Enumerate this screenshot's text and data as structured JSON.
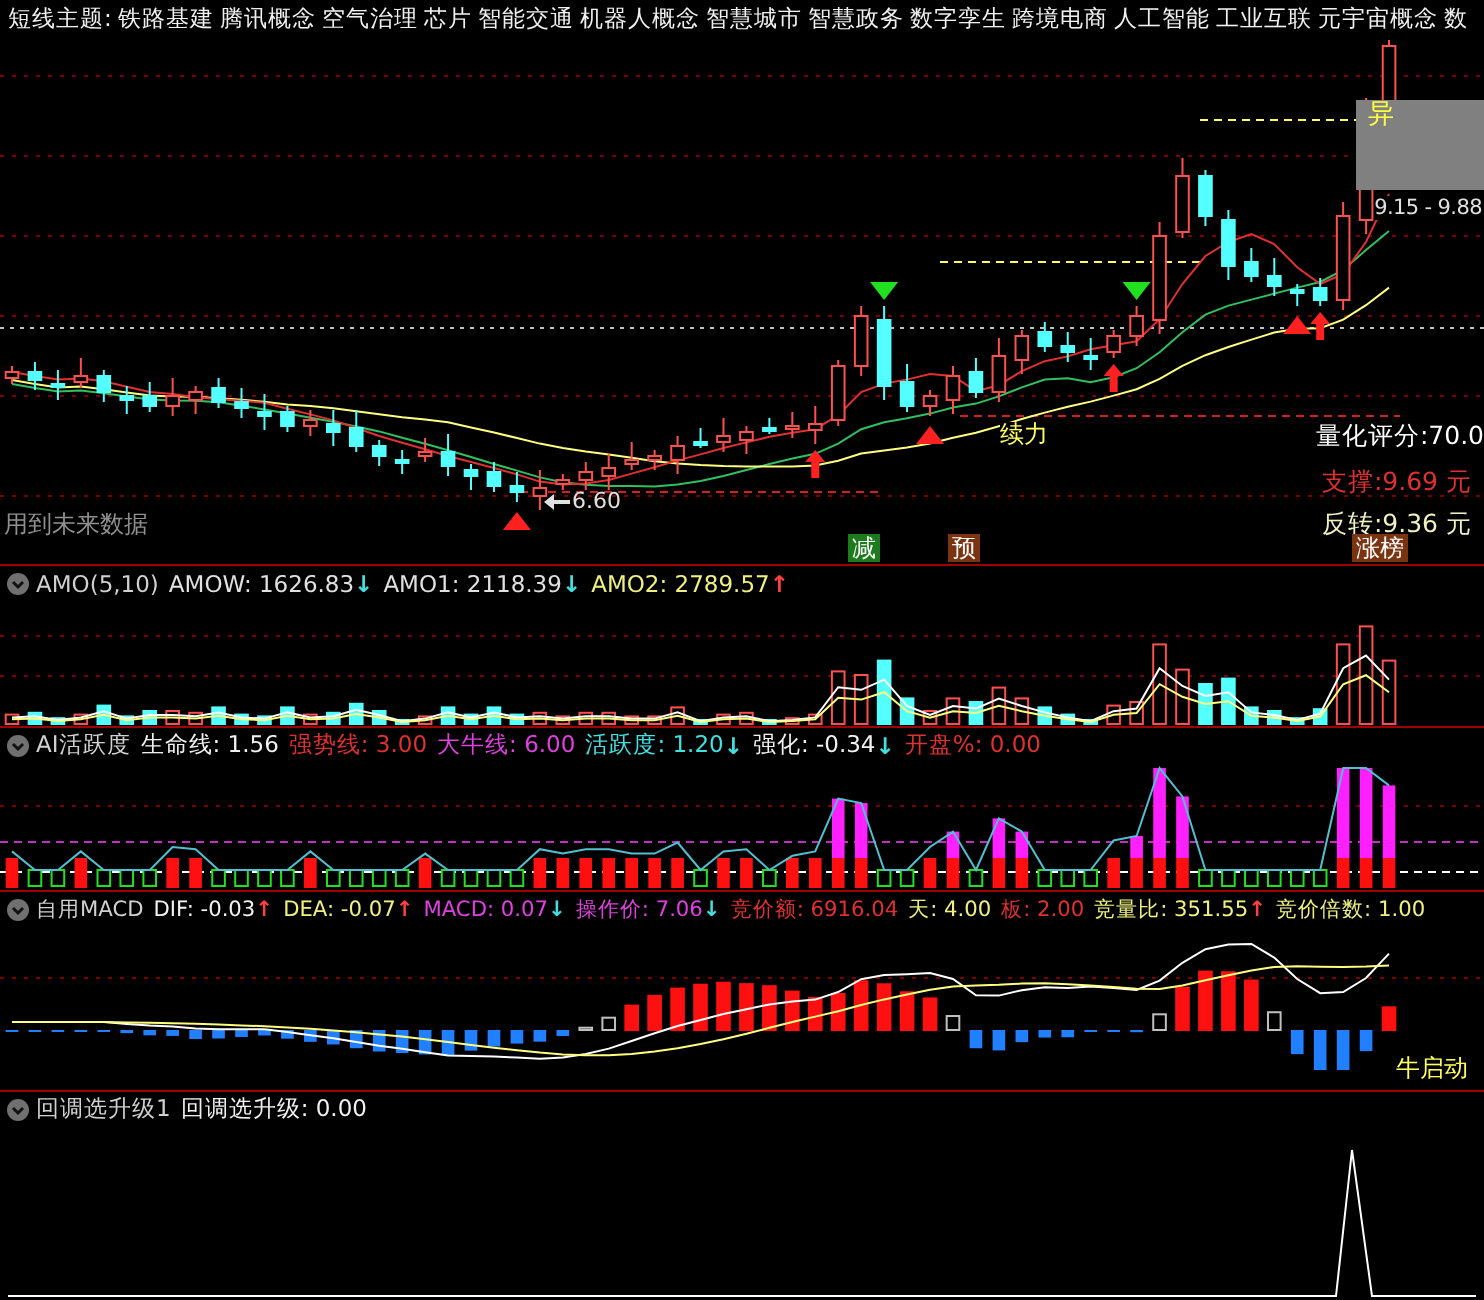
{
  "theme_bar": {
    "label": "短线主题:",
    "themes": [
      "铁路基建",
      "腾讯概念",
      "空气治理",
      "芯片",
      "智能交通",
      "机器人概念",
      "智慧城市",
      "智慧政务",
      "数字孪生",
      "跨境电商",
      "人工智能",
      "工业互联",
      "元宇宙概念",
      "数"
    ]
  },
  "main_chart": {
    "future_data_note": "用到未来数据",
    "low_price": "6.60",
    "range_label": "9.15 - 9.88",
    "signal": "异",
    "momentum_label": "续力",
    "quant_score": "量化评分:70.0",
    "support": "支撑:9.69 元",
    "reversal": "反转:9.36 元",
    "badges": [
      {
        "text": "减",
        "color": "#1d7a1d"
      },
      {
        "text": "预",
        "color": "#7a3412"
      },
      {
        "text": "涨榜",
        "color": "#7a3412"
      }
    ]
  },
  "panels": [
    {
      "kind": "amo",
      "title": "AMO(5,10)",
      "items": [
        {
          "text": "AMOW: 1626.83",
          "color": "#e0e0e0",
          "arrow": "↓",
          "rising": false
        },
        {
          "text": "AMO1: 2118.39",
          "color": "#e0e0e0",
          "arrow": "↓",
          "rising": false
        },
        {
          "text": "AMO2: 2789.57",
          "color": "#f0f080",
          "arrow": "↑",
          "rising": true
        }
      ]
    },
    {
      "kind": "activity",
      "title": "AI活跃度",
      "items": [
        {
          "text": "生命线: 1.56",
          "color": "#f0f0f0"
        },
        {
          "text": "强势线: 3.00",
          "color": "#e03030"
        },
        {
          "text": "大牛线: 6.00",
          "color": "#e040e0"
        },
        {
          "text": "活跃度: 1.20",
          "color": "#40e0e0",
          "arrow": "↓",
          "rising": false
        },
        {
          "text": "强化: -0.34",
          "color": "#f0f0f0",
          "arrow": "↓",
          "rising": false
        },
        {
          "text": "开盘%: 0.00",
          "color": "#e03030"
        }
      ]
    },
    {
      "kind": "macd",
      "title": "自用MACD",
      "label": "牛启动",
      "items": [
        {
          "text": "DIF: -0.03",
          "color": "#f0f0f0",
          "arrow": "↑",
          "rising": true
        },
        {
          "text": "DEA: -0.07",
          "color": "#f0f080",
          "arrow": "↑",
          "rising": true
        },
        {
          "text": "MACD: 0.07",
          "color": "#e040e0",
          "arrow": "↓",
          "rising": false
        },
        {
          "text": "操作价: 7.06",
          "color": "#e040e0",
          "arrow": "↓",
          "rising": false
        },
        {
          "text": "竞价额: 6916.04",
          "color": "#e03030"
        },
        {
          "text": "天: 4.00",
          "color": "#f0f080"
        },
        {
          "text": "板: 2.00",
          "color": "#e03030"
        },
        {
          "text": "竞量比: 351.55",
          "color": "#f0f080",
          "arrow": "↑",
          "rising": true
        },
        {
          "text": "竞价倍数: 1.00",
          "color": "#f0f080"
        }
      ]
    },
    {
      "kind": "pullback",
      "title": "回调选升级1",
      "items": [
        {
          "text": "回调选升级: 0.00",
          "color": "#f0f0f0"
        }
      ]
    }
  ]
}
